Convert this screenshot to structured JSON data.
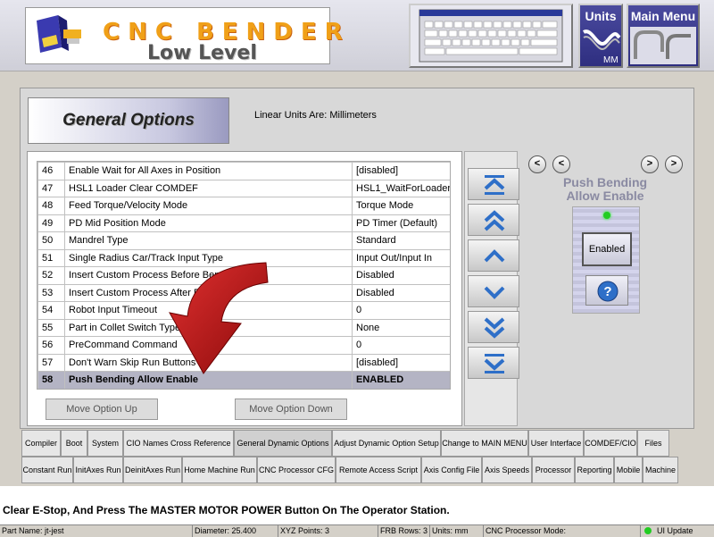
{
  "header": {
    "title": "CNC BENDER",
    "subtitle": "Low Level",
    "units_button_label": "Units",
    "main_menu_button_label": "Main Menu"
  },
  "panel": {
    "section_title": "General Options",
    "units_info": "Linear Units Are: Millimeters",
    "move_up_label": "Move Option Up",
    "move_down_label": "Move Option Down"
  },
  "options": [
    {
      "num": "46",
      "name": "Enable Wait for All Axes in Position",
      "value": "[disabled]"
    },
    {
      "num": "47",
      "name": "HSL1 Loader Clear COMDEF",
      "value": "HSL1_WaitForLoader"
    },
    {
      "num": "48",
      "name": "Feed Torque/Velocity Mode",
      "value": "Torque Mode"
    },
    {
      "num": "49",
      "name": "PD Mid Position Mode",
      "value": "PD Timer (Default)"
    },
    {
      "num": "50",
      "name": "Mandrel Type",
      "value": "Standard"
    },
    {
      "num": "51",
      "name": "Single Radius Car/Track Input Type",
      "value": "Input Out/Input In"
    },
    {
      "num": "52",
      "name": "Insert Custom Process Before Bend",
      "value": "Disabled"
    },
    {
      "num": "53",
      "name": "Insert Custom Process After Bend",
      "value": "Disabled"
    },
    {
      "num": "54",
      "name": "Robot Input Timeout",
      "value": "0"
    },
    {
      "num": "55",
      "name": "Part in Collet Switch Type",
      "value": "None"
    },
    {
      "num": "56",
      "name": "PreCommand Command",
      "value": "0"
    },
    {
      "num": "57",
      "name": "Don't Warn Skip Run Buttons",
      "value": "[disabled]"
    },
    {
      "num": "58",
      "name": "Push Bending Allow Enable",
      "value": "ENABLED"
    }
  ],
  "selected_row": 12,
  "option_detail": {
    "prev_label": "<",
    "next_label": ">",
    "title": "Push Bending\nAllow Enable",
    "toggle_label": "Enabled"
  },
  "tabs_row1": [
    {
      "label": "Compiler",
      "width": 44
    },
    {
      "label": "Boot",
      "width": 30
    },
    {
      "label": "System",
      "width": 40
    },
    {
      "label": "CIO Names Cross Reference",
      "width": 124
    },
    {
      "label": "General Dynamic Options",
      "width": 110,
      "active": true
    },
    {
      "label": "Adjust Dynamic Option Setup",
      "width": 122
    },
    {
      "label": "Change to MAIN MENU",
      "width": 98
    },
    {
      "label": "User Interface",
      "width": 62
    },
    {
      "label": "COMDEF/CIO",
      "width": 60
    },
    {
      "label": "Files",
      "width": 36
    }
  ],
  "tabs_row2": [
    {
      "label": "Constant Run",
      "width": 58
    },
    {
      "label": "InitAxes Run",
      "width": 56
    },
    {
      "label": "DeinitAxes Run",
      "width": 66
    },
    {
      "label": "Home Machine Run",
      "width": 84
    },
    {
      "label": "CNC Processor CFG",
      "width": 88
    },
    {
      "label": "Remote Access Script",
      "width": 96
    },
    {
      "label": "Axis Config File",
      "width": 68
    },
    {
      "label": "Axis Speeds",
      "width": 56
    },
    {
      "label": "Processor",
      "width": 48
    },
    {
      "label": "Reporting",
      "width": 44
    },
    {
      "label": "Mobile",
      "width": 32
    },
    {
      "label": "Machine",
      "width": 40
    }
  ],
  "message": "Clear E-Stop, And Press The MASTER MOTOR POWER Button On The Operator Station.",
  "status_bar": {
    "part_name": "Part Name: jt-jest",
    "diameter": "Diameter: 25.400",
    "xyz_points": "XYZ Points: 3",
    "frb_rows": "FRB Rows: 3",
    "units": "Units: mm",
    "processor_mode": "CNC Processor Mode:",
    "ui_update": "UI Update"
  },
  "colors": {
    "accent_blue": "#2e6fc8",
    "arrow_red": "#b81414",
    "selected_row": "#b4b4c4",
    "title_orange": "#f0a018"
  }
}
